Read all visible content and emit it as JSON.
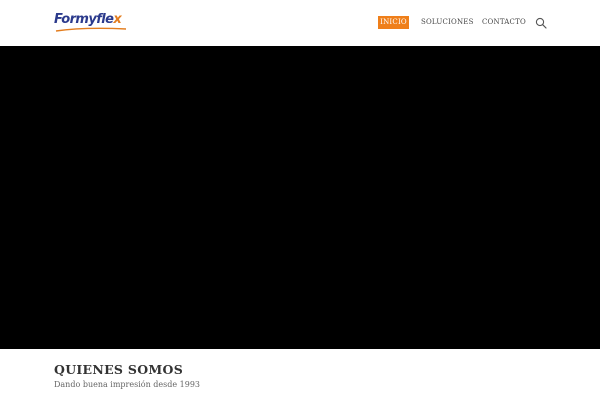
{
  "header": {
    "logo": {
      "text_main": "Formyfle",
      "text_accent": "x",
      "alt": "Formyflex"
    },
    "nav": [
      {
        "label": "INICIO",
        "active": true
      },
      {
        "label": "SOLUCIONES",
        "active": false
      },
      {
        "label": "CONTACTO",
        "active": false
      }
    ],
    "search_icon": "search-icon"
  },
  "hero": {
    "background": "#000000"
  },
  "about": {
    "title": "QUIENES SOMOS",
    "subtitle": "Dando buena impresión desde 1993"
  },
  "colors": {
    "accent": "#ef7f1a",
    "brand_blue": "#2b3a8c",
    "text": "#333333"
  }
}
